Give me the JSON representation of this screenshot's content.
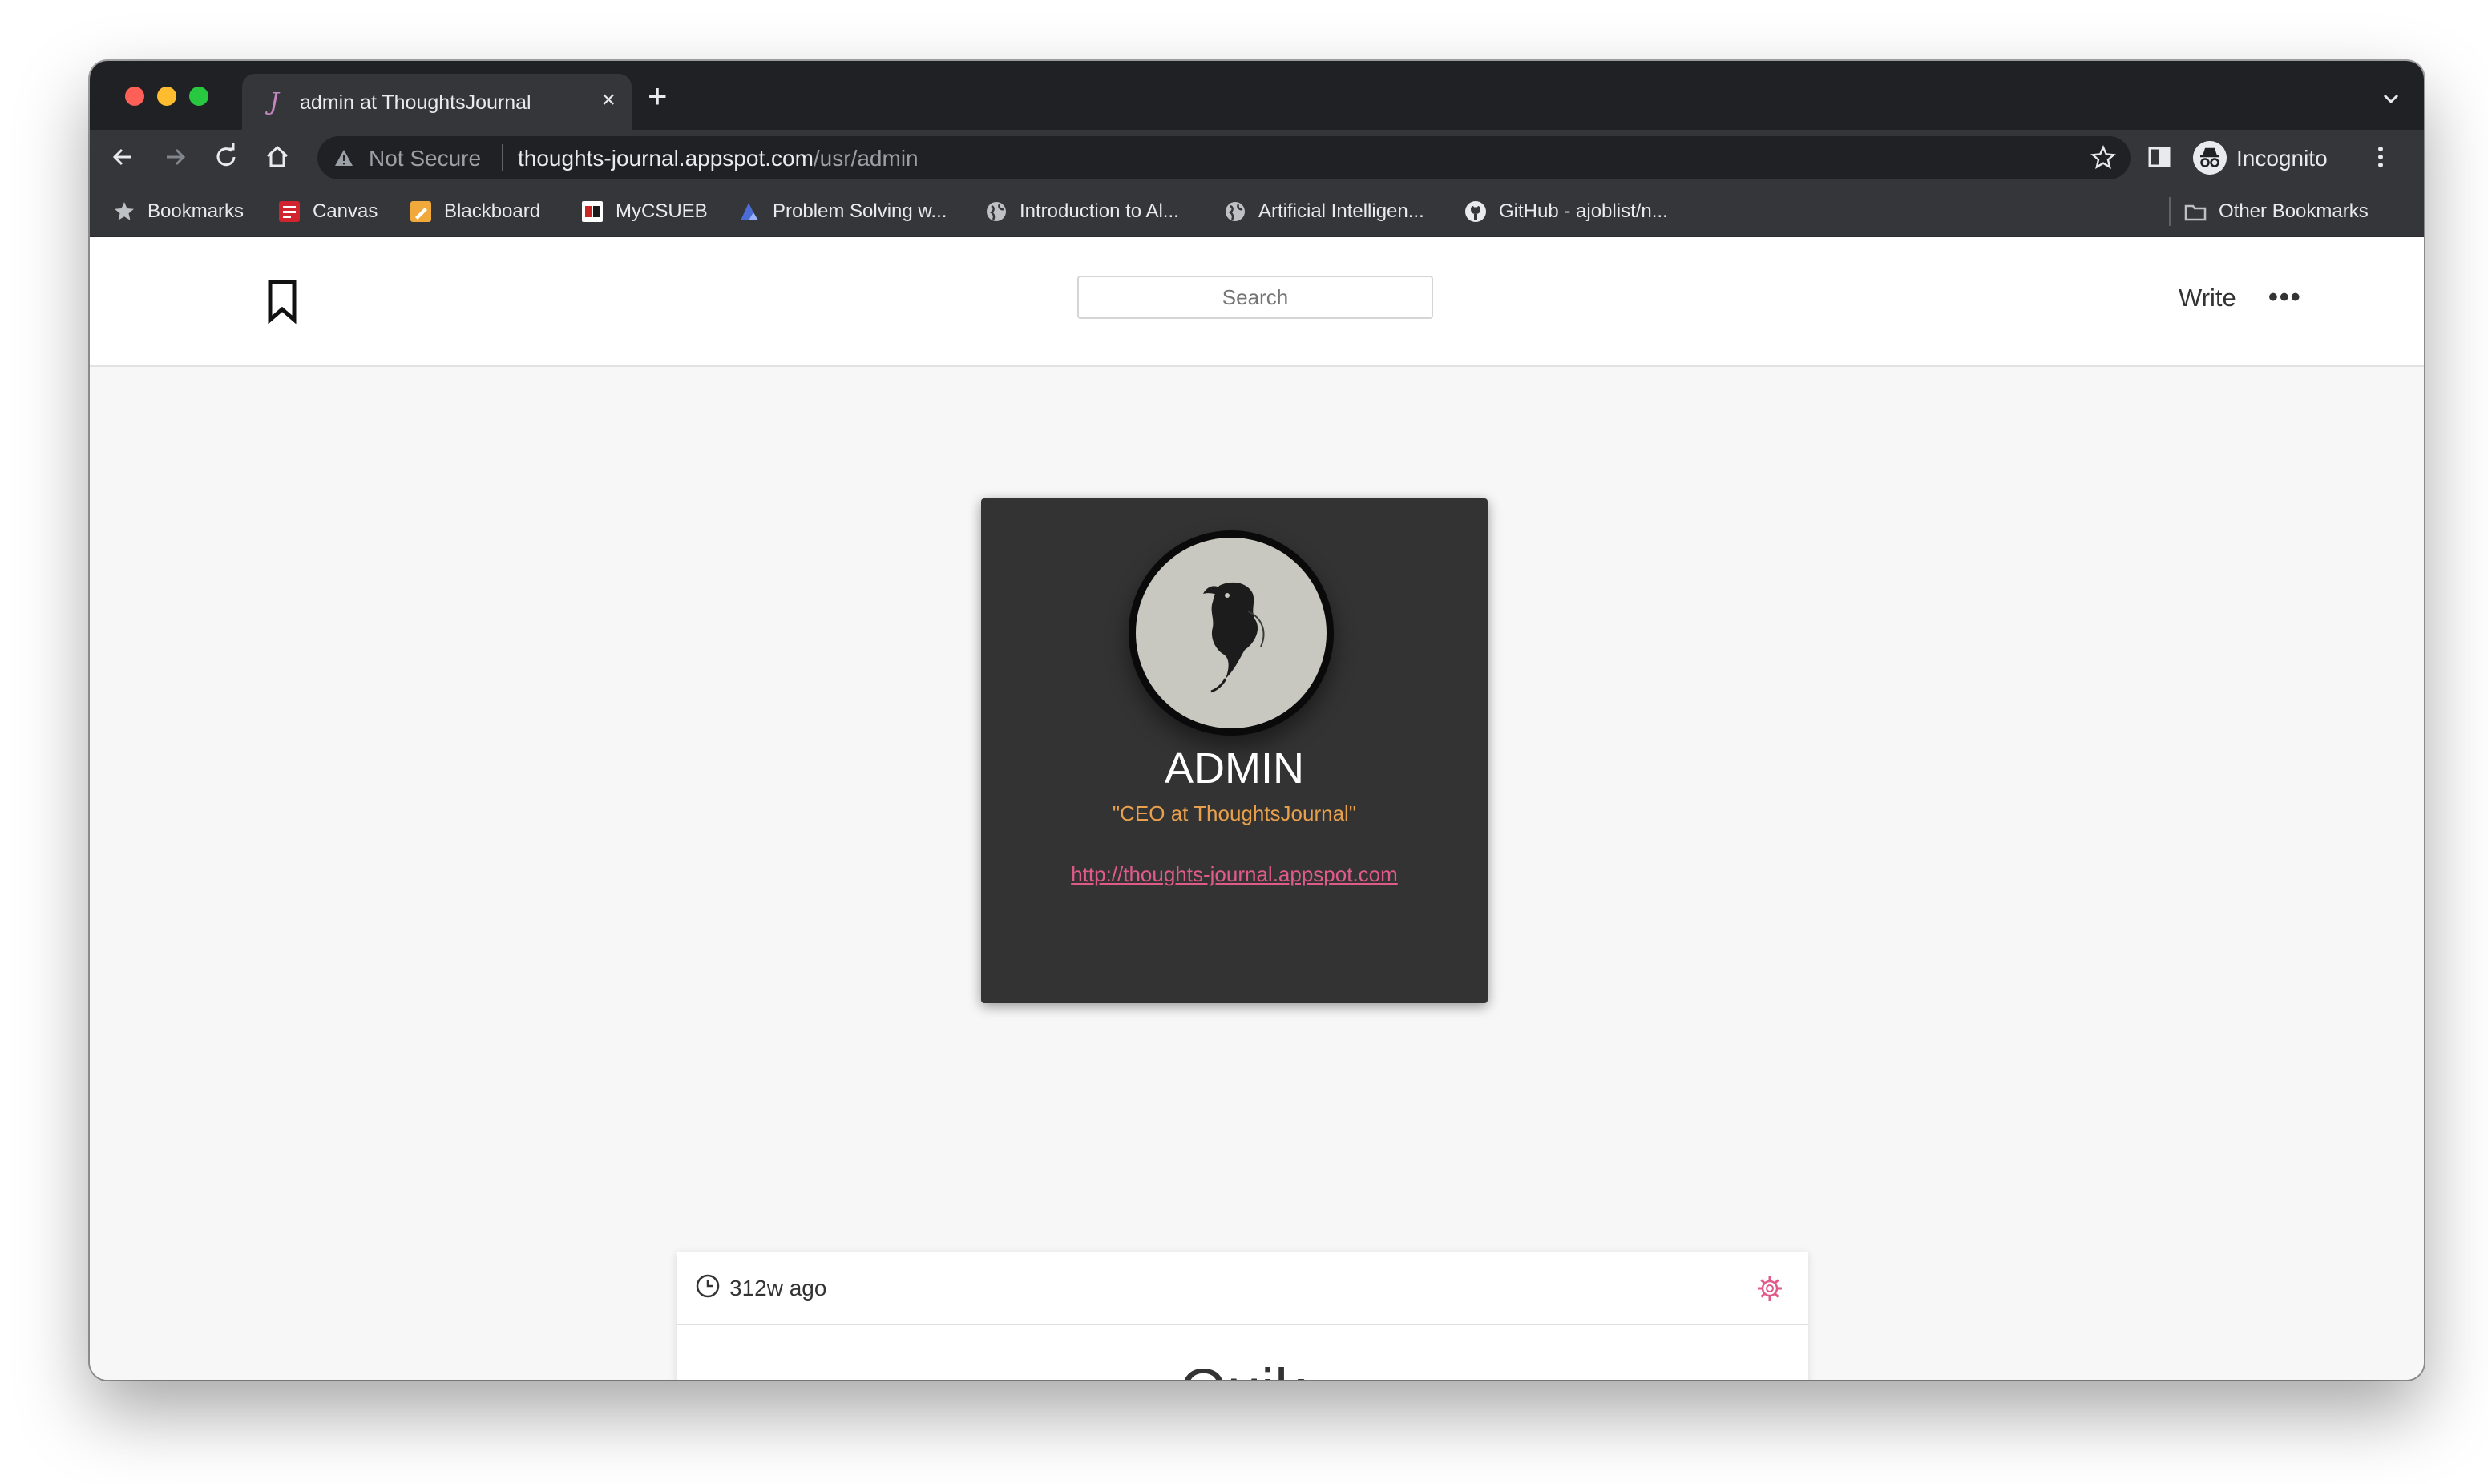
{
  "browser": {
    "tab": {
      "title": "admin at ThoughtsJournal",
      "favicon": "J"
    },
    "omnibox": {
      "security_label": "Not Secure",
      "url_host": "thoughts-journal.appspot.com",
      "url_path": "/usr/admin"
    },
    "profile_label": "Incognito",
    "bookmarks": [
      {
        "label": "Bookmarks",
        "icon": "star-icon"
      },
      {
        "label": "Canvas",
        "icon": "canvas-icon"
      },
      {
        "label": "Blackboard",
        "icon": "blackboard-icon"
      },
      {
        "label": "MyCSUEB",
        "icon": "mycsueb-icon"
      },
      {
        "label": "Problem Solving w...",
        "icon": "problem-solving-icon"
      },
      {
        "label": "Introduction to Al...",
        "icon": "globe-icon"
      },
      {
        "label": "Artificial Intelligen...",
        "icon": "globe-icon"
      },
      {
        "label": "GitHub - ajoblist/n...",
        "icon": "github-icon"
      },
      {
        "label": "Other Bookmarks",
        "icon": "folder-icon"
      }
    ]
  },
  "site": {
    "search_placeholder": "Search",
    "write_label": "Write",
    "more_label": "•••"
  },
  "profile": {
    "name": "ADMIN",
    "tagline": "\"CEO at ThoughtsJournal\"",
    "link": "http://thoughts-journal.appspot.com"
  },
  "post": {
    "time_ago": "312w ago",
    "title": "Quik"
  },
  "colors": {
    "card_bg": "#333333",
    "tagline": "#e8a04c",
    "link": "#e05a8a",
    "page_bg": "#f7f7f7"
  }
}
